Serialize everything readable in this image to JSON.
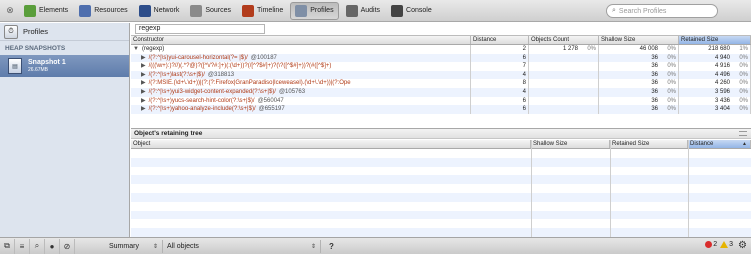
{
  "toolbar": {
    "items": [
      {
        "label": "Elements",
        "icon": "elements-icon",
        "color": "#5a9e3b"
      },
      {
        "label": "Resources",
        "icon": "resources-icon",
        "color": "#4f6fae"
      },
      {
        "label": "Network",
        "icon": "network-icon",
        "color": "#2d4d8a"
      },
      {
        "label": "Sources",
        "icon": "sources-icon",
        "color": "#8a8a8a"
      },
      {
        "label": "Timeline",
        "icon": "timeline-icon",
        "color": "#b23c1c"
      },
      {
        "label": "Profiles",
        "icon": "profiles-icon",
        "color": "#7f8fa6"
      },
      {
        "label": "Audits",
        "icon": "audits-icon",
        "color": "#666666"
      },
      {
        "label": "Console",
        "icon": "console-icon",
        "color": "#444444"
      }
    ],
    "active": "Profiles",
    "search_placeholder": "Search Profiles"
  },
  "sidebar": {
    "profiles_label": "Profiles",
    "heading": "HEAP SNAPSHOTS",
    "snapshot_title": "Snapshot 1",
    "snapshot_size": "26.67MB"
  },
  "filter_value": "regexp",
  "constructors": {
    "headers": [
      "Constructor",
      "Distance",
      "Objects Count",
      "Shallow Size",
      "Retained Size"
    ],
    "sorted_column": "Retained Size",
    "rows": [
      {
        "top": true,
        "expr": "(regexp)",
        "id": "",
        "distance": "2",
        "count": "1 278",
        "count_pct": "0%",
        "shallow": "46 008",
        "shallow_pct": "0%",
        "retained": "218 680",
        "retained_pct": "1%"
      },
      {
        "top": false,
        "expr": "/(?:^|\\s)yui-carousel-horizontal(?= |$)/",
        "id": "@100187",
        "distance": "6",
        "count": "",
        "count_pct": "",
        "shallow": "36",
        "shallow_pct": "0%",
        "retained": "4 940",
        "retained_pct": "0%"
      },
      {
        "top": false,
        "expr": "/(((\\w+):)?//)(.*?@)?([^\\/?#:]+)(:(\\d+))?(/[^?$#]+)?(\\?([^$#]+))?(#([^$]+)",
        "id": "",
        "distance": "7",
        "count": "",
        "count_pct": "",
        "shallow": "36",
        "shallow_pct": "0%",
        "retained": "4 916",
        "retained_pct": "0%"
      },
      {
        "top": false,
        "expr": "/(?:^|\\s+)last(?:\\s+|$)/",
        "id": "@318813",
        "distance": "4",
        "count": "",
        "count_pct": "",
        "shallow": "36",
        "shallow_pct": "0%",
        "retained": "4 496",
        "retained_pct": "0%"
      },
      {
        "top": false,
        "expr": "/(?:MSIE.(\\d+\\.\\d+))|(?:(?:Firefox|GranParadiso|Iceweasel).(\\d+\\.\\d+))|(?:Ope",
        "id": "",
        "distance": "8",
        "count": "",
        "count_pct": "",
        "shallow": "36",
        "shallow_pct": "0%",
        "retained": "4 260",
        "retained_pct": "0%"
      },
      {
        "top": false,
        "expr": "/(?:^|\\s+)yui3-widget-content-expanded(?:\\s+|$)/",
        "id": "@105763",
        "distance": "4",
        "count": "",
        "count_pct": "",
        "shallow": "36",
        "shallow_pct": "0%",
        "retained": "3 596",
        "retained_pct": "0%"
      },
      {
        "top": false,
        "expr": "/(?:^|\\s+)yucs-search-hint-color(?:\\s+|$)/",
        "id": "@560047",
        "distance": "6",
        "count": "",
        "count_pct": "",
        "shallow": "36",
        "shallow_pct": "0%",
        "retained": "3 436",
        "retained_pct": "0%"
      },
      {
        "top": false,
        "expr": "/(?:^|\\s+)yahoo-analyze-include(?:\\s+|$)/",
        "id": "@655197",
        "distance": "6",
        "count": "",
        "count_pct": "",
        "shallow": "36",
        "shallow_pct": "0%",
        "retained": "3 404",
        "retained_pct": "0%"
      }
    ]
  },
  "retaining_tree": {
    "title": "Object's retaining tree",
    "headers": [
      "Object",
      "Shallow Size",
      "Retained Size",
      "Distance"
    ],
    "sorted_column": "Distance"
  },
  "status": {
    "view_label": "Summary",
    "filter_label": "All objects",
    "help": "?",
    "errors": "2",
    "warnings": "3"
  }
}
